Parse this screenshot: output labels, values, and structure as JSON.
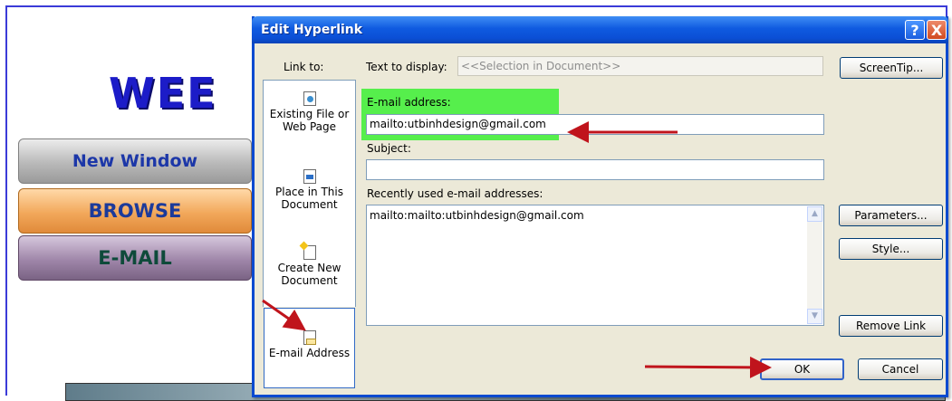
{
  "background_page": {
    "logo_text": "WEE",
    "nav_buttons": [
      "New Window",
      "BROWSE",
      "E-MAIL"
    ]
  },
  "dialog": {
    "title": "Edit Hyperlink",
    "help_glyph": "?",
    "close_glyph": "X",
    "link_to_label": "Link to:",
    "text_to_display_label": "Text to display:",
    "text_to_display_value": "<<Selection in Document>>",
    "screentip_label": "ScreenTip...",
    "link_to_items": [
      {
        "label_line1": "Existing File or",
        "label_line2": "Web Page",
        "icon": "web-page-icon"
      },
      {
        "label_line1": "Place in This",
        "label_line2": "Document",
        "icon": "document-bookmark-icon"
      },
      {
        "label_line1": "Create New",
        "label_line2": "Document",
        "icon": "new-document-icon"
      },
      {
        "label_line1": "E-mail Address",
        "label_line2": "",
        "icon": "email-document-icon",
        "selected": true
      }
    ],
    "email_address_label": "E-mail address:",
    "email_address_value": "mailto:utbinhdesign@gmail.com",
    "subject_label": "Subject:",
    "subject_value": "",
    "recent_label": "Recently used e-mail addresses:",
    "recent_items": [
      "mailto:mailto:utbinhdesign@gmail.com"
    ],
    "parameters_label": "Parameters...",
    "style_label": "Style...",
    "remove_link_label": "Remove Link",
    "ok_label": "OK",
    "cancel_label": "Cancel",
    "colors": {
      "title_bar": "#0b4fd6",
      "highlight": "#56ef4c",
      "annotation_arrow": "#c0141c",
      "dialog_face": "#ece9d8"
    }
  }
}
